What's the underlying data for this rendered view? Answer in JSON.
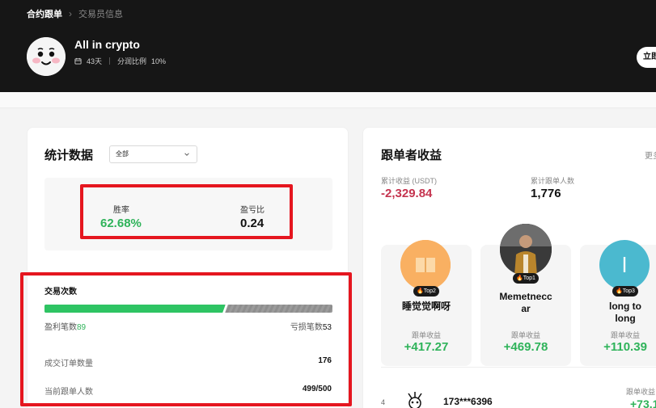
{
  "breadcrumb": {
    "root": "合约跟单",
    "separator": "›",
    "current": "交易员信息"
  },
  "trader": {
    "name": "All in crypto",
    "days": "43天",
    "profit_share_label": "分润比例",
    "profit_share_value": "10%",
    "avatar_icon": "smiley-face-avatar",
    "calendar_icon": "calendar-icon"
  },
  "follow_button": {
    "label": "立即"
  },
  "stats": {
    "title": "统计数据",
    "period_select": "全部",
    "win_rate_label": "胜率",
    "win_rate_value": "62.68%",
    "pl_ratio_label": "盈亏比",
    "pl_ratio_value": "0.24",
    "trades_label": "交易次数",
    "profit_trades_label": "盈利笔数",
    "profit_trades_value": "89",
    "loss_trades_label": "亏损笔数",
    "loss_trades_value": "53",
    "filled_orders_label": "成交订单数量",
    "filled_orders_value": "176",
    "current_followers_label": "当前跟单人数",
    "current_followers_value": "499/500"
  },
  "earnings": {
    "title": "跟单者收益",
    "more_label": "更多",
    "cumulative_label": "累计收益 (USDT)",
    "cumulative_value": "-2,329.84",
    "total_followers_label": "累计跟单人数",
    "total_followers_value": "1,776",
    "top": [
      {
        "rank_badge": "Top2",
        "name": "睡觉觉啊呀",
        "earn_label": "跟单收益",
        "earn_value": "+417.27"
      },
      {
        "rank_badge": "Top1",
        "name": "Memetneccar",
        "name_line1": "Memetnecc",
        "name_line2": "ar",
        "earn_label": "跟单收益",
        "earn_value": "+469.78"
      },
      {
        "rank_badge": "Top3",
        "name": "long to long",
        "name_line1": "long to",
        "name_line2": "long",
        "avatar_letter": "l",
        "earn_label": "跟单收益",
        "earn_value": "+110.39"
      }
    ],
    "rank4": {
      "rank": "4",
      "name": "173***6396",
      "earn_label": "跟单收益",
      "earn_value": "+73.1"
    }
  },
  "colors": {
    "header_bg": "#161616",
    "win_green": "#2fb35a",
    "loss_red": "#c5344f",
    "highlight_red": "#e5161f",
    "top3_avatar": "#4bb9cf",
    "top2_avatar": "#f9b062"
  },
  "chart_data": {
    "type": "bar",
    "categories": [
      "盈利笔数",
      "亏损笔数"
    ],
    "values": [
      89,
      53
    ],
    "xlabel": "",
    "ylabel": "",
    "title": ""
  }
}
